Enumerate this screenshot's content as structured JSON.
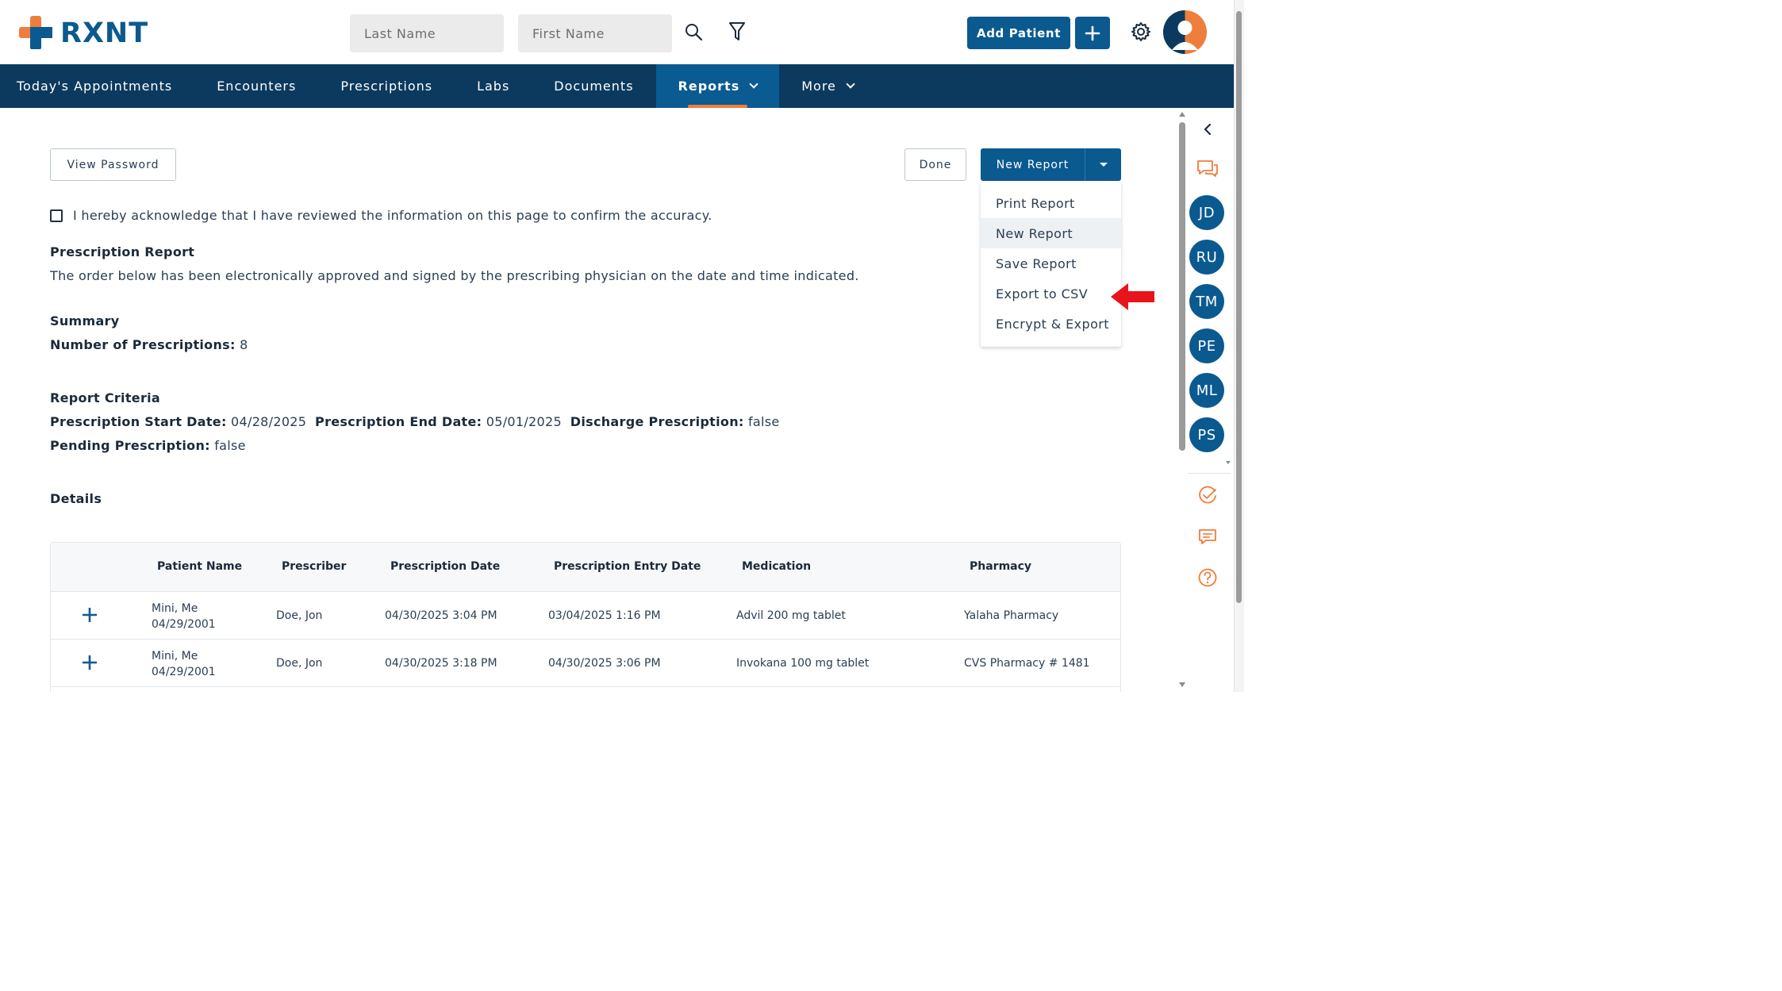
{
  "header": {
    "logo_text": "RXNT",
    "last_name_placeholder": "Last Name",
    "first_name_placeholder": "First Name",
    "add_patient_label": "Add Patient",
    "accent_color": "#0a5a90",
    "brand_orange": "#ef7d3c"
  },
  "nav": {
    "items": [
      {
        "label": "Today's Appointments"
      },
      {
        "label": "Encounters"
      },
      {
        "label": "Prescriptions"
      },
      {
        "label": "Labs"
      },
      {
        "label": "Documents"
      },
      {
        "label": "Reports",
        "active": true
      },
      {
        "label": "More"
      }
    ]
  },
  "actions": {
    "view_password": "View Password",
    "done": "Done",
    "new_report": "New Report"
  },
  "dropdown": {
    "items": [
      "Print Report",
      "New Report",
      "Save Report",
      "Export to CSV",
      "Encrypt & Export"
    ]
  },
  "report": {
    "acknowledgement": "I hereby acknowledge that I have reviewed the information on this page to confirm the accuracy.",
    "title": "Prescription Report",
    "description": "The order below has been electronically approved and signed by the prescribing physician on the date and time indicated.",
    "summary_heading": "Summary",
    "num_prescriptions_label": "Number of Prescriptions:",
    "num_prescriptions_value": "8",
    "criteria_heading": "Report Criteria",
    "start_label": "Prescription Start Date:",
    "start_value": "04/28/2025",
    "end_label": "Prescription End Date:",
    "end_value": "05/01/2025",
    "discharge_label": "Discharge Prescription:",
    "discharge_value": "false",
    "pending_label": "Pending Prescription:",
    "pending_value": "false",
    "details_heading": "Details"
  },
  "table": {
    "columns": [
      "Patient Name",
      "Prescriber",
      "Prescription Date",
      "Prescription Entry Date",
      "Medication",
      "Pharmacy"
    ],
    "rows": [
      {
        "patient_name": "Mini, Me",
        "patient_dob": "04/29/2001",
        "prescriber": "Doe, Jon",
        "prescription_date": "04/30/2025 3:04 PM",
        "entry_date": "03/04/2025 1:16 PM",
        "medication": "Advil 200 mg tablet",
        "pharmacy": "Yalaha Pharmacy"
      },
      {
        "patient_name": "Mini, Me",
        "patient_dob": "04/29/2001",
        "prescriber": "Doe, Jon",
        "prescription_date": "04/30/2025 3:18 PM",
        "entry_date": "04/30/2025 3:06 PM",
        "medication": "Invokana 100 mg tablet",
        "pharmacy": "CVS Pharmacy # 1481"
      }
    ]
  },
  "rail": {
    "avatars": [
      "JD",
      "RU",
      "TM",
      "PE",
      "ML",
      "PS"
    ]
  }
}
